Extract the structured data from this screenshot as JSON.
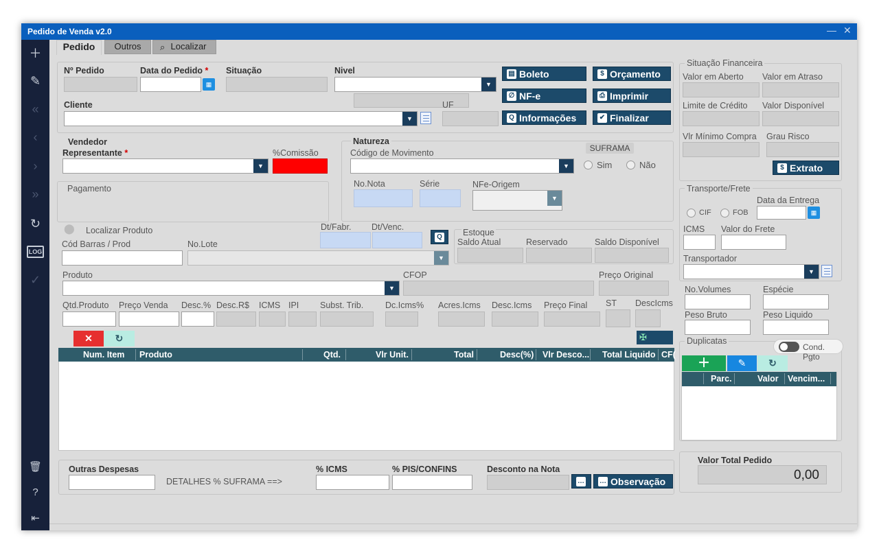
{
  "window": {
    "title": "Pedido de Venda v2.0"
  },
  "tabs": [
    {
      "label": "Pedido"
    },
    {
      "label": "Outros"
    },
    {
      "label": "Localizar"
    }
  ],
  "pedido": {
    "no_pedido_label": "Nº Pedido",
    "data_label": "Data do Pedido",
    "situacao_label": "Situação",
    "nivel_label": "Nivel",
    "cliente_label": "Cliente",
    "uf_label": "UF",
    "required_mark": "*"
  },
  "actions": {
    "boleto": "Boleto",
    "nfe": "NF-e",
    "informacoes": "Informações",
    "orcamento": "Orçamento",
    "imprimir": "Imprimir",
    "finalizar": "Finalizar"
  },
  "vendedor": {
    "title": "Vendedor",
    "representante_label": "Representante",
    "comissao_label": "%Comissão",
    "pagamento_label": "Pagamento"
  },
  "natureza": {
    "title": "Natureza",
    "codigo_label": "Código de Movimento",
    "suframa_label": "SUFRAMA",
    "sim_label": "Sim",
    "nao_label": "Não",
    "no_nota_label": "No.Nota",
    "serie_label": "Série",
    "nfe_origem_label": "NFe-Origem"
  },
  "produto": {
    "localizar_label": "Localizar Produto",
    "cod_barras_label": "Cód Barras / Prod",
    "no_lote_label": "No.Lote",
    "dt_fabr_label": "Dt/Fabr.",
    "dt_venc_label": "Dt/Venc.",
    "estoque_title": "Estoque",
    "saldo_atual_label": "Saldo Atual",
    "reservado_label": "Reservado",
    "saldo_disp_label": "Saldo Disponível",
    "produto_label": "Produto",
    "cfop_label": "CFOP",
    "preco_original_label": "Preço Original",
    "qtd_label": "Qtd.Produto",
    "preco_venda_label": "Preço Venda",
    "desc_pct_label": "Desc.%",
    "desc_rs_label": "Desc.R$",
    "icms_label": "ICMS",
    "ipi_label": "IPI",
    "subst_label": "Subst. Trib.",
    "dc_icms_label": "Dc.Icms%",
    "acres_icms_label": "Acres.Icms",
    "desc_icms_label": "Desc.Icms",
    "preco_final_label": "Preço Final",
    "st_label": "ST",
    "descicms_label": "DescIcms"
  },
  "items_grid": {
    "columns": [
      "Num. Item",
      "Produto",
      "Qtd.",
      "Vlr Unit.",
      "Total",
      "Desc(%)",
      "Vlr Desco...",
      "Total Liquido",
      "CF("
    ]
  },
  "footer": {
    "outras_despesas_label": "Outras Despesas",
    "detalhes_suframa": "DETALHES % SUFRAMA ==>",
    "icms_label": "% ICMS",
    "pis_label": "% PIS/CONFINS",
    "desconto_label": "Desconto na Nota",
    "observacao": "Observação"
  },
  "financeira": {
    "title": "Situação Financeira",
    "valor_aberto": "Valor em Aberto",
    "valor_atraso": "Valor em Atraso",
    "limite_credito": "Limite de Crédito",
    "valor_disponivel": "Valor Disponível",
    "vlr_minimo": "Vlr Mínimo Compra",
    "grau_risco": "Grau Risco",
    "extrato": "Extrato"
  },
  "transporte": {
    "title": "Transporte/Frete",
    "cif": "CIF",
    "fob": "FOB",
    "data_entrega": "Data da Entrega",
    "icms": "ICMS",
    "valor_frete": "Valor do Frete",
    "transportador": "Transportador",
    "no_volumes": "No.Volumes",
    "especie": "Espécie",
    "peso_bruto": "Peso Bruto",
    "peso_liquido": "Peso Liquido"
  },
  "duplicatas": {
    "title": "Duplicatas",
    "cond_pgto": "Cond. Pgto",
    "columns": [
      "Parc.",
      "Valor",
      "Vencim..."
    ]
  },
  "total": {
    "label": "Valor Total Pedido",
    "value": "0,00"
  },
  "colors": {
    "titlebar": "#0a5fbd",
    "sidebar": "#17213a",
    "button": "#1c4a6a",
    "grid_header": "#2f5c6a",
    "commission": "#ff0000",
    "add": "#1aa356",
    "edit": "#1787e0"
  }
}
